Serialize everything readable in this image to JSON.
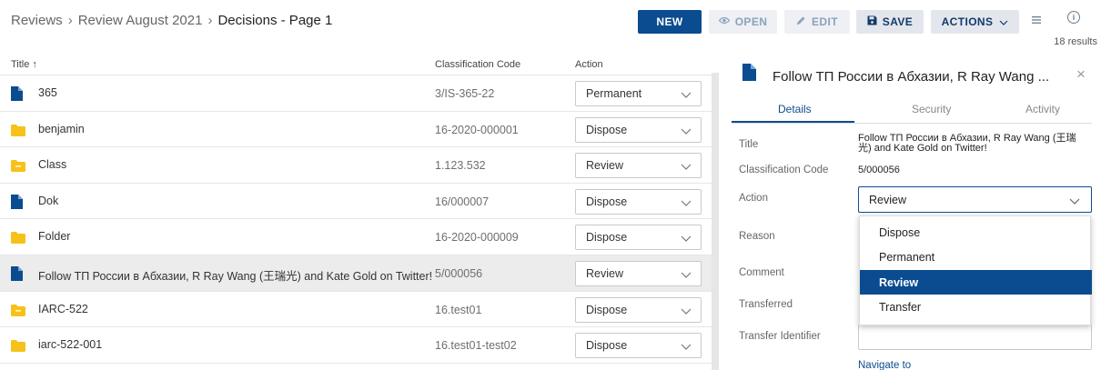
{
  "breadcrumb": {
    "items": [
      "Reviews",
      "Review August 2021"
    ],
    "current": "Decisions - Page 1"
  },
  "toolbar": {
    "new": "NEW",
    "open": "OPEN",
    "edit": "EDIT",
    "save": "SAVE",
    "actions": "ACTIONS"
  },
  "result_count": "18 results",
  "table": {
    "columns": {
      "title": "Title ↑",
      "code": "Classification Code",
      "action": "Action"
    },
    "rows": [
      {
        "icon": "doc-icon",
        "title": "365",
        "code": "3/IS-365-22",
        "action": "Permanent"
      },
      {
        "icon": "folder-icon",
        "title": "benjamin",
        "code": "16-2020-000001",
        "action": "Dispose"
      },
      {
        "icon": "class-icon",
        "title": "Class",
        "code": "1.123.532",
        "action": "Review"
      },
      {
        "icon": "doc-icon",
        "title": "Dok",
        "code": "16/000007",
        "action": "Dispose"
      },
      {
        "icon": "folder-icon",
        "title": "Folder",
        "code": "16-2020-000009",
        "action": "Dispose"
      },
      {
        "icon": "doc-icon",
        "title": "Follow ТП России в Абхазии, R Ray Wang (王瑞光) and Kate Gold on Twitter!",
        "code": "5/000056",
        "action": "Review"
      },
      {
        "icon": "class-icon",
        "title": "IARC-522",
        "code": "16.test01",
        "action": "Dispose"
      },
      {
        "icon": "folder-icon",
        "title": "iarc-522-001",
        "code": "16.test01-test02",
        "action": "Dispose"
      }
    ]
  },
  "panel": {
    "title": "Follow ТП России в Абхазии, R Ray Wang ...",
    "tabs": [
      "Details",
      "Security",
      "Activity"
    ],
    "labels": {
      "title": "Title",
      "code": "Classification Code",
      "action": "Action",
      "reason": "Reason",
      "comment": "Comment",
      "transferred": "Transferred",
      "transfer_id": "Transfer Identifier"
    },
    "title_value_line1": "Follow ТП России в Абхазии, R Ray Wang (王瑞",
    "title_value_line2": "光) and Kate Gold on Twitter!",
    "code_value": "5/000056",
    "action_value": "Review",
    "options": [
      "Dispose",
      "Permanent",
      "Review",
      "Transfer"
    ],
    "navigate_link": "Navigate to"
  },
  "colors": {
    "primary": "#0b4b8f",
    "folder": "#f6c21a"
  }
}
